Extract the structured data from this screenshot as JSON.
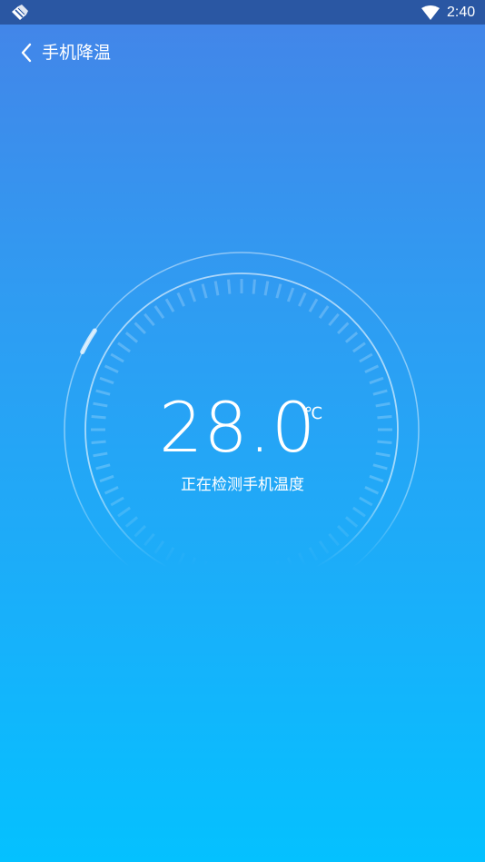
{
  "status_bar": {
    "time": "2:40",
    "left_icon": "notification-app-icon",
    "wifi_icon": "wifi-icon"
  },
  "header": {
    "back_icon": "chevron-left-icon",
    "title": "手机降温"
  },
  "gauge": {
    "temperature": "28.0",
    "unit": "℃",
    "status": "正在检测手机温度"
  },
  "colors": {
    "status_bar": "#2a57a3",
    "gradient_top": "#4484e8",
    "gradient_bottom": "#04c1ff",
    "text": "#ffffff"
  }
}
